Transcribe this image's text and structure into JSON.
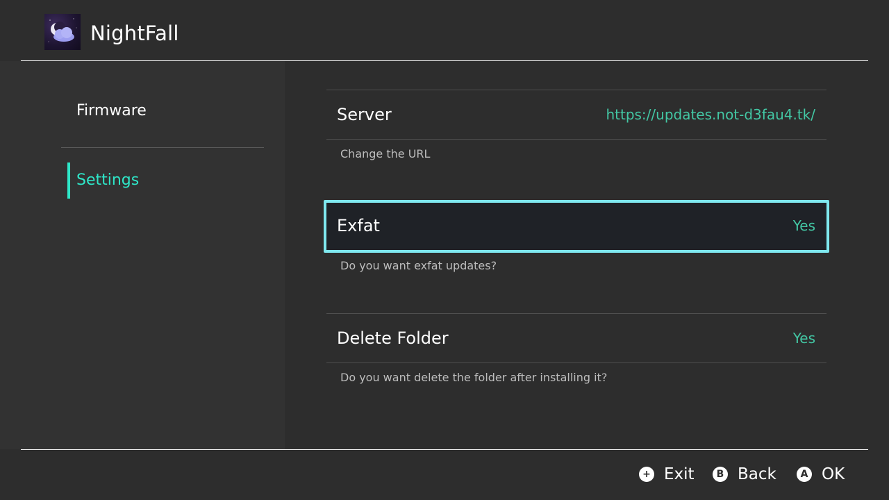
{
  "header": {
    "app_name": "NightFall",
    "icon": "moon-cloud-icon"
  },
  "sidebar": {
    "items": [
      {
        "label": "Firmware",
        "selected": false
      },
      {
        "label": "Settings",
        "selected": true
      }
    ]
  },
  "settings": {
    "items": [
      {
        "title": "Server",
        "value": "https://updates.not-d3fau4.tk/",
        "description": "Change the URL",
        "focused": false
      },
      {
        "title": "Exfat",
        "value": "Yes",
        "description": "Do you want exfat updates?",
        "focused": true
      },
      {
        "title": "Delete Folder",
        "value": "Yes",
        "description": "Do you want delete the folder after installing it?",
        "focused": false
      }
    ]
  },
  "footer": {
    "hints": [
      {
        "button": "+",
        "label": "Exit",
        "icon": "plus-button-icon"
      },
      {
        "button": "B",
        "label": "Back",
        "icon": "b-button-icon"
      },
      {
        "button": "A",
        "label": "OK",
        "icon": "a-button-icon"
      }
    ]
  },
  "colors": {
    "background": "#2d2d2d",
    "sidebar": "#323232",
    "accent": "#2ee6c8",
    "value": "#43c7a4",
    "focus_border": "#7fe8ef",
    "focus_bg": "#1f2227"
  }
}
